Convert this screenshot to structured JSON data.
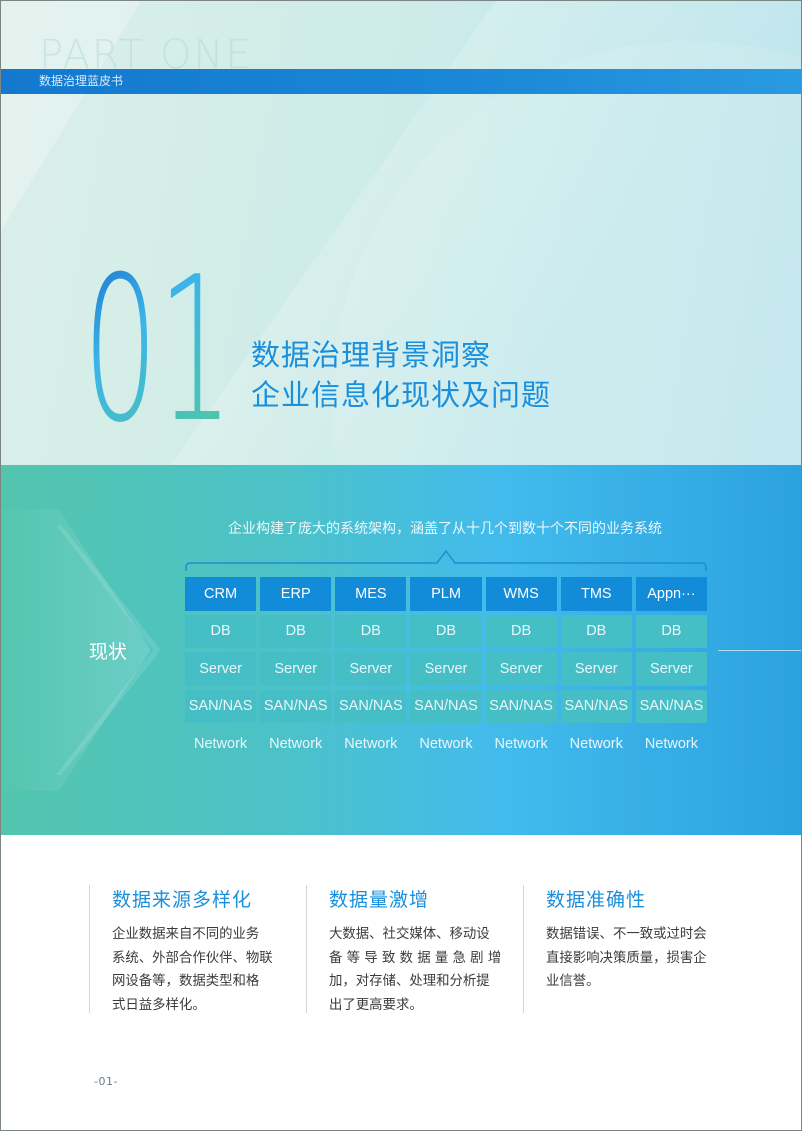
{
  "header": {
    "watermark": "PART ONE",
    "bar_label": "数据治理蓝皮书"
  },
  "chapter": {
    "number": "01",
    "title_line1": "数据治理背景洞察",
    "title_line2": "企业信息化现状及问题"
  },
  "colors": {
    "accent_blue": "#1a8fdc",
    "bar_blue": "#1478cf",
    "app_cell": "#128bd9",
    "infra_cell": "#46bec6",
    "network_cell": "#12194a"
  },
  "status_panel": {
    "label": "现状",
    "caption": "企业构建了庞大的系统架构，涵盖了从十几个到数十个不同的业务系统",
    "rows": [
      {
        "layer": "app",
        "cells": [
          "CRM",
          "ERP",
          "MES",
          "PLM",
          "WMS",
          "TMS",
          "Appn···"
        ]
      },
      {
        "layer": "db",
        "cells": [
          "DB",
          "DB",
          "DB",
          "DB",
          "DB",
          "DB",
          "DB"
        ]
      },
      {
        "layer": "server",
        "cells": [
          "Server",
          "Server",
          "Server",
          "Server",
          "Server",
          "Server",
          "Server"
        ]
      },
      {
        "layer": "san",
        "cells": [
          "SAN/NAS",
          "SAN/NAS",
          "SAN/NAS",
          "SAN/NAS",
          "SAN/NAS",
          "SAN/NAS",
          "SAN/NAS"
        ]
      },
      {
        "layer": "network",
        "cells": [
          "Network",
          "Network",
          "Network",
          "Network",
          "Network",
          "Network",
          "Network"
        ]
      }
    ]
  },
  "issues": [
    {
      "title": "数据来源多样化",
      "lines": [
        "企业数据来自不同的业务",
        "系统、外部合作伙伴、物联",
        "网设备等，数据类型和格",
        "式日益多样化。"
      ]
    },
    {
      "title": "数据量激增",
      "lines": [
        "大数据、社交媒体、移动设",
        "备 等 导 致 数 据 量 急 剧 增",
        "加，对存储、处理和分析提",
        "出了更高要求。"
      ]
    },
    {
      "title": "数据准确性",
      "lines": [
        "数据错误、不一致或过时会",
        "直接影响决策质量，损害企",
        "业信誉。"
      ]
    }
  ],
  "footer": {
    "page_number": "-01-"
  }
}
